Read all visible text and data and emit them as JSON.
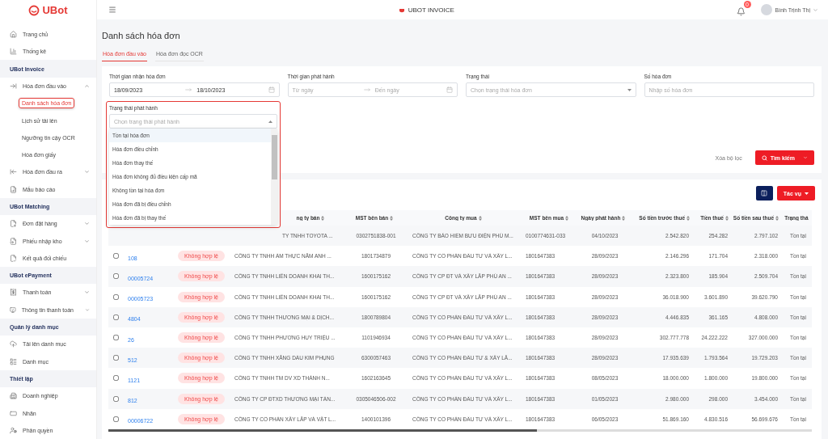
{
  "header": {
    "brand": "UBot",
    "title": "UBOT INVOICE",
    "notification_count": "0",
    "user": "Bình Trịnh Thị"
  },
  "sidebar": [
    {
      "kind": "item",
      "label": "Trang chủ"
    },
    {
      "kind": "item",
      "label": "Thống kê"
    },
    {
      "kind": "section",
      "label": "UBot Invoice"
    },
    {
      "kind": "item",
      "label": "Hóa đơn đầu vào",
      "expanded": true
    },
    {
      "kind": "subitem",
      "label": "Danh sách hóa đơn",
      "selected": true
    },
    {
      "kind": "subitem",
      "label": "Lịch sử tải lên",
      "selected": false
    },
    {
      "kind": "subitem",
      "label": "Ngưỡng tin cậy OCR",
      "selected": false
    },
    {
      "kind": "subitem",
      "label": "Hóa đơn giấy",
      "selected": false
    },
    {
      "kind": "item",
      "label": "Hóa đơn đầu ra",
      "expanded": false
    },
    {
      "kind": "item",
      "label": "Mẫu báo cáo"
    },
    {
      "kind": "section",
      "label": "UBot Matching"
    },
    {
      "kind": "item",
      "label": "Đơn đặt hàng",
      "expanded": false
    },
    {
      "kind": "item",
      "label": "Phiếu nhập kho",
      "expanded": false
    },
    {
      "kind": "item",
      "label": "Kết quả đối chiếu"
    },
    {
      "kind": "section",
      "label": "UBot ePayment"
    },
    {
      "kind": "item",
      "label": "Thanh toán",
      "expanded": false
    },
    {
      "kind": "item",
      "label": "Thông tin thanh toán",
      "expanded": false
    },
    {
      "kind": "section",
      "label": "Quản lý danh mục"
    },
    {
      "kind": "item",
      "label": "Tải lên danh mục"
    },
    {
      "kind": "item",
      "label": "Danh mục"
    },
    {
      "kind": "section",
      "label": "Thiết lập"
    },
    {
      "kind": "item",
      "label": "Doanh nghiệp"
    },
    {
      "kind": "item",
      "label": "Nhãn"
    },
    {
      "kind": "item",
      "label": "Phân quyền"
    }
  ],
  "page_title": "Danh sách hóa đơn",
  "tabs": [
    {
      "label": "Hóa đơn đầu vào",
      "selected": true
    },
    {
      "label": "Hóa đơn đọc OCR",
      "selected": false
    }
  ],
  "filters": [
    {
      "kind": "daterange",
      "label": "Thời gian nhận hóa đơn",
      "start": "18/09/2023",
      "end": "18/10/2023"
    },
    {
      "kind": "daterange",
      "label": "Thời gian phát hành",
      "start_placeholder": "Từ ngày",
      "end_placeholder": "Đến ngày"
    },
    {
      "kind": "select",
      "label": "Trạng thái",
      "placeholder": "Chọn trạng thái hóa đơn"
    },
    {
      "kind": "text",
      "label": "Số hóa đơn",
      "placeholder": "Nhập số hóa đơn"
    }
  ],
  "open_select": {
    "label": "Trạng thái phát hành",
    "placeholder": "Chọn trạng thái phát hành",
    "options": [
      {
        "label": "Tồn tại hóa đơn",
        "selected": true
      },
      {
        "label": "Hóa đơn điều chỉnh",
        "selected": false
      },
      {
        "label": "Hóa đơn thay thế",
        "selected": false
      },
      {
        "label": "Hóa đơn không đủ điều kiện cấp mã",
        "selected": false
      },
      {
        "label": "Không tồn tại hóa đơn",
        "selected": false
      },
      {
        "label": "Hóa đơn đã bị điều chỉnh",
        "selected": false
      },
      {
        "label": "Hóa đơn đã bị thay thế",
        "selected": false
      }
    ]
  },
  "clear_filter": "Xóa bộ lọc",
  "search_button": "Tìm kiếm",
  "actions_button": "Tác vụ",
  "table": {
    "columns": [
      "ng ty bán",
      "MST bên bán",
      "Công ty mua",
      "MST bên mua",
      "Ngày phát hành",
      "Số tiền trước thuế",
      "Tiền thuế",
      "Số tiền sau thuế",
      "Trạng thá"
    ],
    "rows": [
      {
        "seller": "TY TNHH TOYOTA ...",
        "seller_tax": "0302751838-001",
        "buyer": "CÔNG TY BẢO HIỂM BƯU ĐIỆN PHÚ M...",
        "buyer_tax": "0100774631-033",
        "date": "04/10/2023",
        "pre_tax": "2.542.820",
        "tax": "254.282",
        "total": "2.797.102",
        "state": "Tồn tại"
      },
      {
        "number": "108",
        "status": "Không hợp lệ",
        "checked": false,
        "seller": "CÔNG TY TNHH ẨM THỰC NĂM ANH ...",
        "seller_tax": "1801734879",
        "buyer": "CÔNG TY CỔ PHẦN ĐẦU TƯ VÀ XÂY L...",
        "buyer_tax": "1801647383",
        "date": "28/09/2023",
        "pre_tax": "2.146.296",
        "tax": "171.704",
        "total": "2.318.000",
        "state": "Tồn tại"
      },
      {
        "number": "00005724",
        "status": "Không hợp lệ",
        "checked": false,
        "seller": "CÔNG TY TNHH LIÊN DOANH KHAI TH...",
        "seller_tax": "1600175162",
        "buyer": "CÔNG TY CP ĐT VÀ XÂY LẮP PHÚ AN ...",
        "buyer_tax": "1801647383",
        "date": "28/09/2023",
        "pre_tax": "2.323.800",
        "tax": "185.904",
        "total": "2.509.704",
        "state": "Tồn tại"
      },
      {
        "number": "00005723",
        "status": "Không hợp lệ",
        "checked": false,
        "seller": "CÔNG TY TNHH LIÊN DOANH KHAI TH...",
        "seller_tax": "1600175162",
        "buyer": "CÔNG TY CP ĐT VÀ XÂY LẮP PHÚ AN ...",
        "buyer_tax": "1801647383",
        "date": "28/09/2023",
        "pre_tax": "36.018.900",
        "tax": "3.601.890",
        "total": "39.620.790",
        "state": "Tồn tại"
      },
      {
        "number": "4804",
        "status": "Không hợp lệ",
        "checked": false,
        "seller": "CÔNG TY TNHH THƯƠNG MẠI & DỊCH...",
        "seller_tax": "1800789804",
        "buyer": "CÔNG TY CỔ PHẦN ĐẦU TƯ VÀ XÂY L...",
        "buyer_tax": "1801647383",
        "date": "28/09/2023",
        "pre_tax": "4.446.835",
        "tax": "361.165",
        "total": "4.808.000",
        "state": "Tồn tại"
      },
      {
        "number": "26",
        "status": "Không hợp lệ",
        "checked": false,
        "seller": "CÔNG TY TNHH PHƯƠNG HUY TRIỆU ...",
        "seller_tax": "1101946934",
        "buyer": "CÔNG TY CỔ PHẦN ĐẦU TƯ VÀ XÂY L...",
        "buyer_tax": "1801647383",
        "date": "28/09/2023",
        "pre_tax": "302.777.778",
        "tax": "24.222.222",
        "total": "327.000.000",
        "state": "Tồn tại"
      },
      {
        "number": "512",
        "status": "Không hợp lệ",
        "checked": false,
        "seller": "CÔNG TY TNHH XĂNG DẦU KIM PHỤNG",
        "seller_tax": "6300057463",
        "buyer": "CÔNG TY CỔ PHẦN ĐẦU TƯ & XÂY LẮ...",
        "buyer_tax": "1801647383",
        "date": "28/09/2023",
        "pre_tax": "17.935.639",
        "tax": "1.793.564",
        "total": "19.729.203",
        "state": "Tồn tại"
      },
      {
        "number": "1121",
        "status": "Không hợp lệ",
        "checked": false,
        "seller": "CÔNG TY TNHH TM DV XD THÀNH N...",
        "seller_tax": "1602163645",
        "buyer": "CÔNG TY CỔ PHẦN ĐẦU TƯ VÀ XÂY L...",
        "buyer_tax": "1801647383",
        "date": "08/05/2023",
        "pre_tax": "18.000.000",
        "tax": "1.800.000",
        "total": "19.800.000",
        "state": "Tồn tại"
      },
      {
        "number": "812",
        "status": "Không hợp lệ",
        "checked": false,
        "seller": "CÔNG TY CP ĐTXD THƯƠNG MẠI TẤN...",
        "seller_tax": "0305046506-002",
        "buyer": "CÔNG TY CỔ PHẦN ĐẦU TƯ VÀ XÂY L...",
        "buyer_tax": "1801647383",
        "date": "01/05/2023",
        "pre_tax": "2.980.000",
        "tax": "298.000",
        "total": "3.454.000",
        "state": "Tồn tại"
      },
      {
        "number": "00006722",
        "status": "Không hợp lệ",
        "checked": false,
        "seller": "CÔNG TY CỔ PHẦN XÂY LẮP VÀ VẬT L...",
        "seller_tax": "1400101396",
        "buyer": "CÔNG TY CỔ PHẦN ĐẦU TƯ VÀ XÂY L...",
        "buyer_tax": "1801647383",
        "date": "06/05/2023",
        "pre_tax": "51.869.160",
        "tax": "4.830.516",
        "total": "56.699.676",
        "state": "Tồn tại"
      }
    ]
  }
}
